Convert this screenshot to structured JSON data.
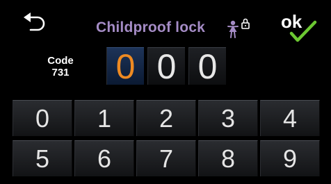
{
  "header": {
    "title": "Childproof lock",
    "back_icon": "back-arrow-icon",
    "lock_icon": "child-lock-icon",
    "ok_label": "ok"
  },
  "code_hint": {
    "label": "Code",
    "value": "731"
  },
  "entry": {
    "digits": [
      "0",
      "0",
      "0"
    ],
    "active_index": 0
  },
  "keypad": {
    "keys": [
      "0",
      "1",
      "2",
      "3",
      "4",
      "5",
      "6",
      "7",
      "8",
      "9"
    ]
  },
  "colors": {
    "title": "#a58cc6",
    "active_digit": "#ee8a22",
    "check": "#6cc832",
    "background": "#000000"
  }
}
